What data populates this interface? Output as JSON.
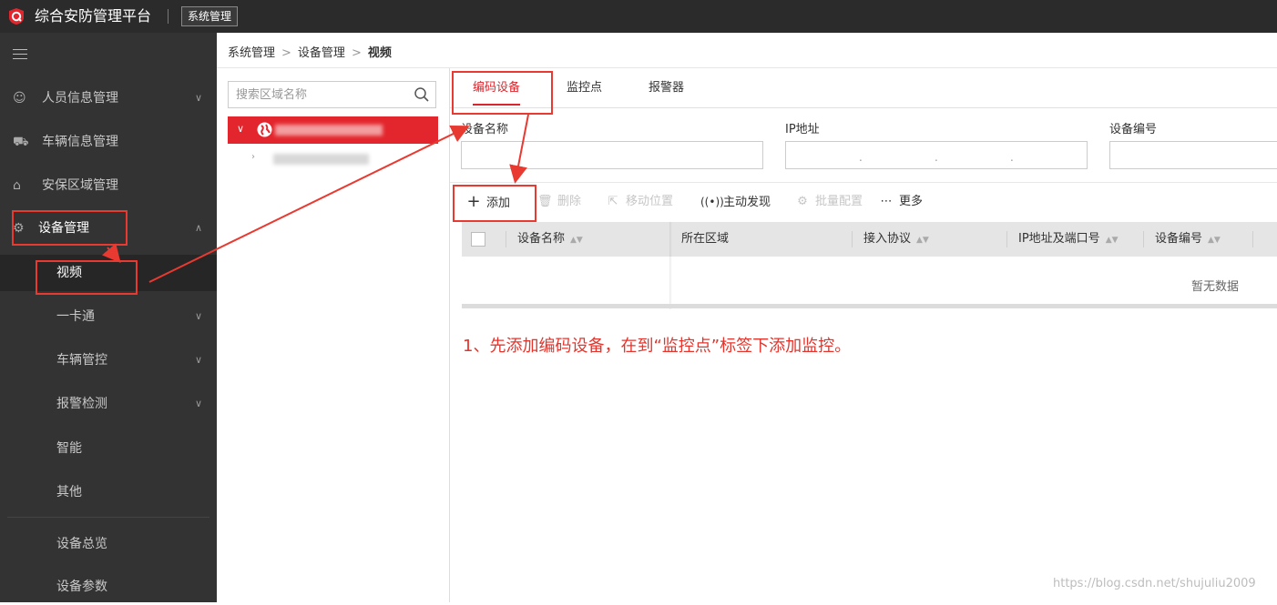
{
  "app": {
    "title": "综合安防管理平台",
    "system_button": "系统管理"
  },
  "colors": {
    "accent": "#e3262d",
    "sidebar_bg": "#333333",
    "topbar_bg": "#2b2b2b",
    "annotation": "#e83a31"
  },
  "sidebar": {
    "items": [
      {
        "label": "人员信息管理",
        "icon": "person-icon",
        "has_chevron": true
      },
      {
        "label": "车辆信息管理",
        "icon": "truck-icon",
        "has_chevron": false
      },
      {
        "label": "安保区域管理",
        "icon": "home-shield-icon",
        "has_chevron": false
      },
      {
        "label": "设备管理",
        "icon": "device-gear-icon",
        "expanded": true
      }
    ],
    "sub_items": [
      {
        "label": "视频",
        "active": true
      },
      {
        "label": "一卡通",
        "has_chevron": true
      },
      {
        "label": "车辆管控",
        "has_chevron": true
      },
      {
        "label": "报警检测",
        "has_chevron": true
      },
      {
        "label": "智能"
      },
      {
        "label": "其他"
      },
      {
        "label": "设备总览"
      },
      {
        "label": "设备参数"
      }
    ]
  },
  "breadcrumb": [
    "系统管理",
    "设备管理",
    "视频"
  ],
  "tree": {
    "search_placeholder": "搜索区域名称"
  },
  "tabs": [
    {
      "label": "编码设备",
      "active": true
    },
    {
      "label": "监控点"
    },
    {
      "label": "报警器"
    }
  ],
  "filters": {
    "device_name_label": "设备名称",
    "ip_label": "IP地址",
    "device_code_label": "设备编号"
  },
  "toolbar": {
    "add": "添加",
    "delete": "删除",
    "move": "移动位置",
    "discover": "主动发现",
    "batch_config": "批量配置",
    "more": "更多"
  },
  "table": {
    "columns": [
      "设备名称",
      "所在区域",
      "接入协议",
      "IP地址及端口号",
      "设备编号"
    ],
    "empty_text": "暂无数据"
  },
  "instruction": "1、先添加编码设备，在到“监控点”标签下添加监控。",
  "watermark": "https://blog.csdn.net/shujuliu2009"
}
